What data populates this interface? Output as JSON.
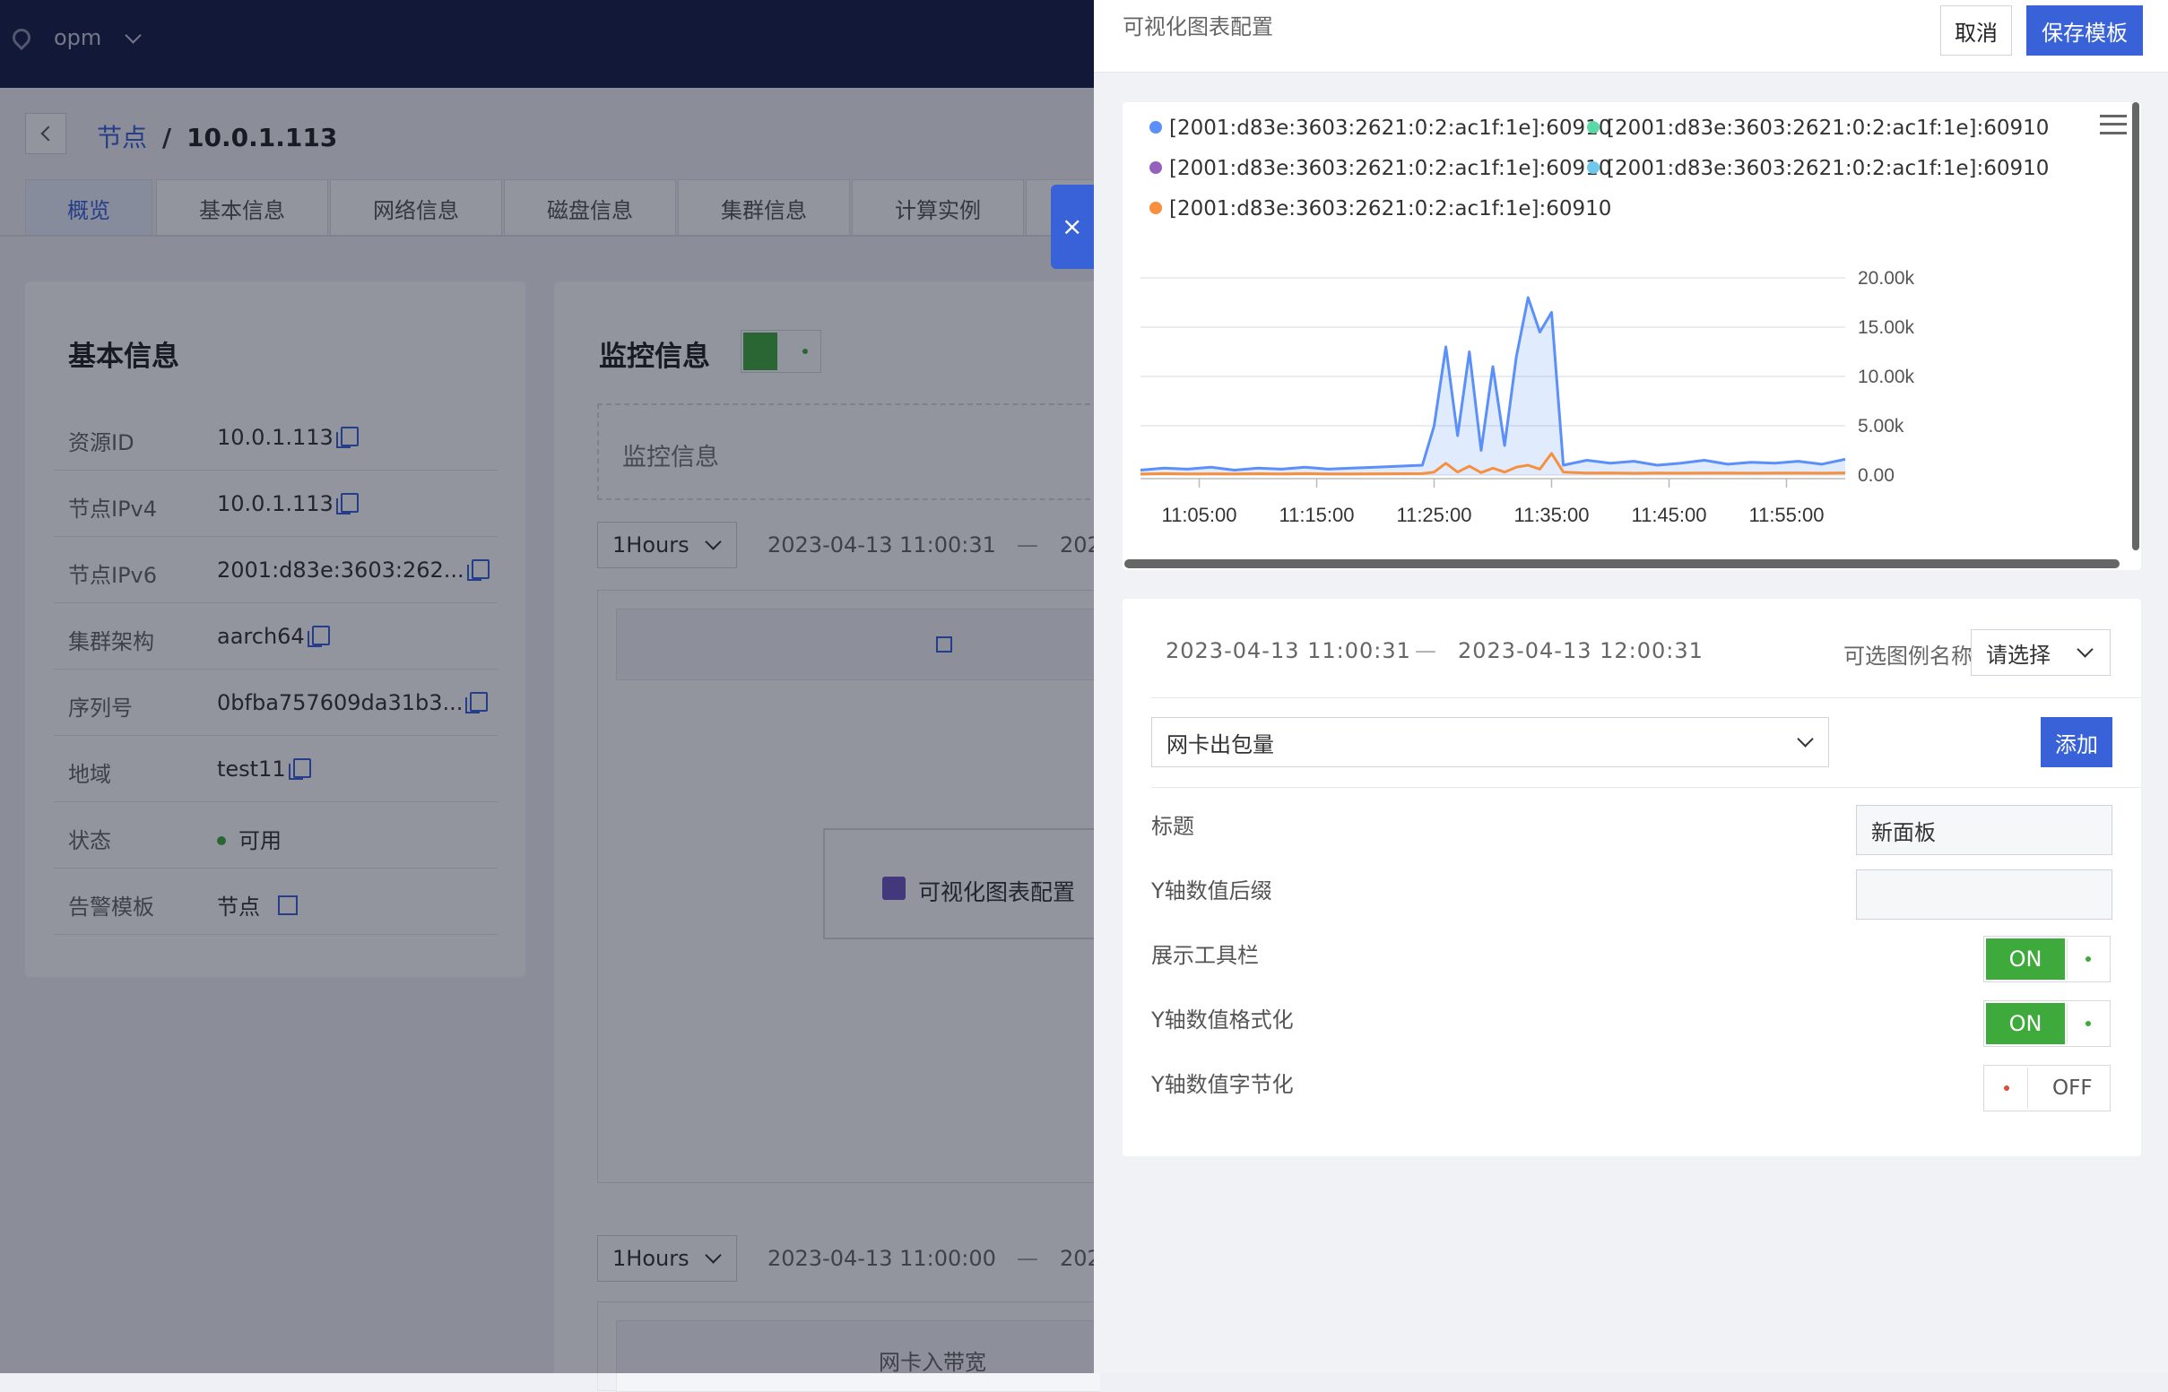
{
  "topbar": {
    "location": "opm"
  },
  "breadcrumb": {
    "parent": "节点",
    "separator": "/",
    "current": "10.0.1.113"
  },
  "tabs": [
    "概览",
    "基本信息",
    "网络信息",
    "磁盘信息",
    "集群信息",
    "计算实例"
  ],
  "basic_info": {
    "title": "基本信息",
    "rows": [
      {
        "label": "资源ID",
        "value": "10.0.1.113"
      },
      {
        "label": "节点IPv4",
        "value": "10.0.1.113"
      },
      {
        "label": "节点IPv6",
        "value": "2001:d83e:3603:262..."
      },
      {
        "label": "集群架构",
        "value": "aarch64"
      },
      {
        "label": "序列号",
        "value": "0bfba757609da31b3..."
      },
      {
        "label": "地域",
        "value": "test11"
      },
      {
        "label": "状态",
        "value": "可用"
      },
      {
        "label": "告警模板",
        "value": "节点"
      }
    ]
  },
  "monitor": {
    "title": "监控信息",
    "placeholder_box": "监控信息",
    "range1": "1Hours",
    "time1": "2023-04-13 11:00:31",
    "time1_sep": "—",
    "time1_cut": "202",
    "config_button": "可视化图表配置",
    "range2": "1Hours",
    "time2": "2023-04-13 11:00:00",
    "time2_sep": "—",
    "time2_cut": "202",
    "panel2_title": "网卡入带宽"
  },
  "drawer": {
    "title": "可视化图表配置",
    "cancel": "取消",
    "save": "保存模板",
    "start_time": "2023-04-13 11:00:31",
    "time_sep": "—",
    "end_time": "2023-04-13 12:00:31",
    "legend_select_label": "可选图例名称",
    "legend_select_value": "请选择",
    "metric_value": "网卡出包量",
    "add": "添加",
    "form": {
      "title_label": "标题",
      "title_value": "新面板",
      "suffix_label": "Y轴数值后缀",
      "suffix_value": "",
      "toolbar_label": "展示工具栏",
      "toolbar_state": "ON",
      "format_label": "Y轴数值格式化",
      "format_state": "ON",
      "bytes_label": "Y轴数值字节化",
      "bytes_state": "OFF"
    }
  },
  "chart_data": {
    "type": "area",
    "legend": [
      {
        "name": "[2001:d83e:3603:2621:0:2:ac1f:1e]:60910",
        "color": "#5b8ff9"
      },
      {
        "name": "[2001:d83e:3603:2621:0:2:ac1f:1e]:60910",
        "color": "#5ad8a6"
      },
      {
        "name": "[2001:d83e:3603:2621:0:2:ac1f:1e]:60910",
        "color": "#9661bc"
      },
      {
        "name": "[2001:d83e:3603:2621:0:2:ac1f:1e]:60910",
        "color": "#6dc8ec"
      },
      {
        "name": "[2001:d83e:3603:2621:0:2:ac1f:1e]:60910",
        "color": "#f6903d"
      }
    ],
    "x_ticks": [
      "11:05:00",
      "11:15:00",
      "11:25:00",
      "11:35:00",
      "11:45:00",
      "11:55:00"
    ],
    "y_ticks": [
      "0.00",
      "5.00k",
      "10.00k",
      "15.00k",
      "20.00k"
    ],
    "ylim": [
      0,
      20000
    ],
    "x": [
      "11:00",
      "11:02",
      "11:04",
      "11:06",
      "11:08",
      "11:10",
      "11:12",
      "11:14",
      "11:16",
      "11:18",
      "11:20",
      "11:22",
      "11:24",
      "11:25",
      "11:26",
      "11:27",
      "11:28",
      "11:29",
      "11:30",
      "11:31",
      "11:32",
      "11:33",
      "11:34",
      "11:35",
      "11:36",
      "11:38",
      "11:40",
      "11:42",
      "11:44",
      "11:46",
      "11:48",
      "11:50",
      "11:52",
      "11:54",
      "11:56",
      "11:58",
      "12:00"
    ],
    "series": [
      {
        "color": "#5b8ff9",
        "values": [
          500,
          700,
          600,
          800,
          500,
          700,
          600,
          800,
          600,
          700,
          800,
          900,
          1000,
          5000,
          13000,
          4000,
          12500,
          2500,
          11000,
          3000,
          12000,
          18000,
          14500,
          16500,
          1000,
          1500,
          1200,
          1400,
          1000,
          1200,
          1500,
          1100,
          1300,
          1200,
          1400,
          1100,
          1600
        ]
      },
      {
        "color": "#f6903d",
        "values": [
          100,
          150,
          120,
          130,
          110,
          140,
          120,
          150,
          110,
          120,
          130,
          140,
          150,
          300,
          1200,
          300,
          900,
          250,
          700,
          300,
          800,
          1000,
          600,
          2200,
          300,
          200,
          220,
          180,
          200,
          190,
          210,
          200,
          190,
          210,
          200,
          190,
          220
        ]
      }
    ]
  }
}
